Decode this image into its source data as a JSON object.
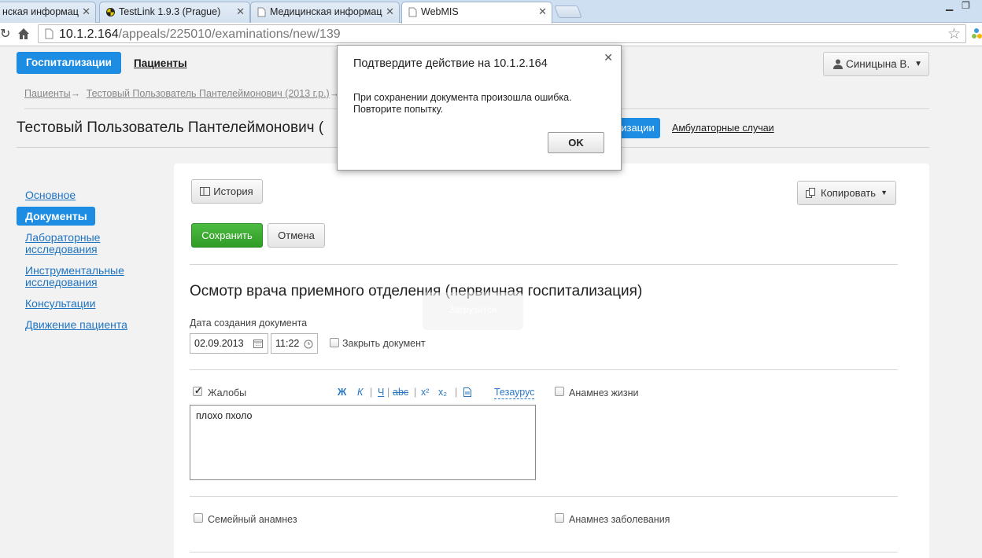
{
  "browser": {
    "tabs": [
      {
        "label": "нская информац"
      },
      {
        "label": "TestLink 1.9.3 (Prague)"
      },
      {
        "label": "Медицинская информац"
      },
      {
        "label": "WebMIS"
      }
    ],
    "url_host": "10.1.2.164",
    "url_path": "/appeals/225010/examinations/new/139"
  },
  "nav": {
    "hospitalization": "Госпитализации",
    "patients": "Пациенты",
    "user": "Синицына В."
  },
  "breadcrumb": {
    "patients": "Пациенты",
    "arrow": "→",
    "patient": "Тестовый Пользователь Пантелеймонович (2013 г.р.)"
  },
  "patient": {
    "name": "Тестовый Пользователь Пантелеймонович (",
    "tab_hosp_partial": "изации",
    "tab_ambulatory": "Амбулаторные случаи"
  },
  "sidebar": {
    "items": [
      {
        "label": "Основное"
      },
      {
        "label": "Документы"
      },
      {
        "label": "Лабораторные исследования"
      },
      {
        "label": "Инструментальные исследования"
      },
      {
        "label": "Консультации"
      },
      {
        "label": "Движение пациента"
      }
    ]
  },
  "toolbar": {
    "history": "История",
    "copy": "Копировать",
    "save": "Сохранить",
    "cancel": "Отмена"
  },
  "form": {
    "title": "Осмотр врача приемного отделения (первичная госпитализация)",
    "date_label": "Дата создания документа",
    "date_value": "02.09.2013",
    "time_value": "11:22",
    "close_doc": "Закрыть документ",
    "complaints": "Жалобы",
    "complaints_text": "плохо пхоло",
    "thesaurus": "Тезаурус",
    "life_anamnesis": "Анамнез жизни",
    "family_anamnesis": "Семейный анамнез",
    "disease_anamnesis": "Анамнез заболевания",
    "loading": "Загрузится",
    "fmt": {
      "bold": "Ж",
      "italic": "К",
      "underline": "Ч",
      "strike": "abc",
      "sup": "x²",
      "sub": "x₂"
    }
  },
  "dialog": {
    "title": "Подтвердите действие на 10.1.2.164",
    "line1": "При сохранении документа произошла ошибка.",
    "line2": "Повторите попытку.",
    "ok": "OK"
  }
}
